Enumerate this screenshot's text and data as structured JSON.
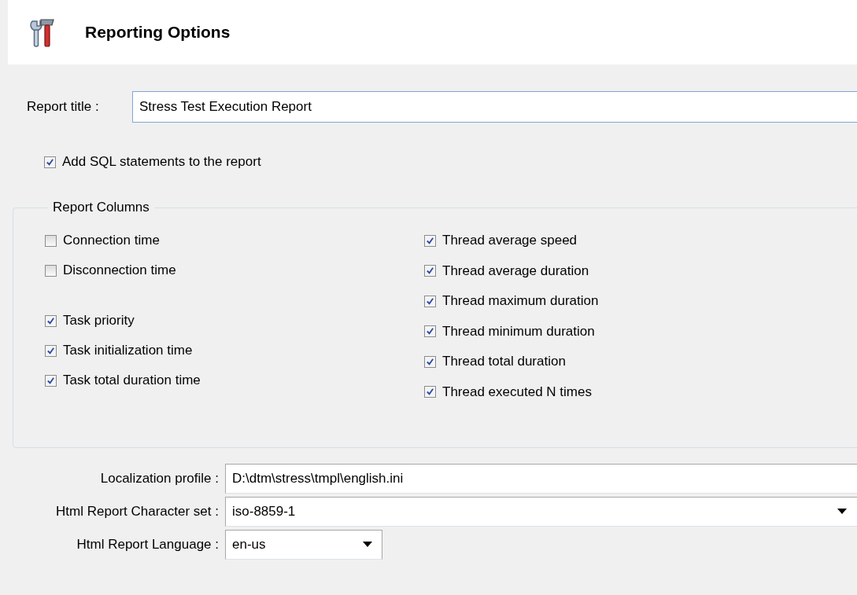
{
  "header": {
    "title": "Reporting Options"
  },
  "report_title": {
    "label": "Report title :",
    "value": "Stress Test Execution Report"
  },
  "add_sql": {
    "label": "Add SQL statements to the report",
    "checked": true
  },
  "report_columns": {
    "title": "Report Columns",
    "columns": [
      {
        "groups": [
          {
            "items": [
              {
                "label": "Connection time",
                "checked": false
              },
              {
                "label": "Disconnection time",
                "checked": false
              }
            ]
          },
          {
            "items": [
              {
                "label": "Task priority",
                "checked": true
              },
              {
                "label": "Task initialization time",
                "checked": true
              },
              {
                "label": "Task total duration time",
                "checked": true
              }
            ]
          }
        ]
      },
      {
        "groups": [
          {
            "items": [
              {
                "label": "Thread average speed",
                "checked": true
              },
              {
                "label": "Thread average duration",
                "checked": true
              },
              {
                "label": "Thread maximum duration",
                "checked": true
              },
              {
                "label": "Thread minimum duration",
                "checked": true
              },
              {
                "label": "Thread total duration",
                "checked": true
              },
              {
                "label": "Thread executed N times",
                "checked": true
              }
            ]
          }
        ]
      }
    ]
  },
  "fields": [
    {
      "kind": "text",
      "label": "Localization profile :",
      "value": "D:\\dtm\\stress\\tmpl\\english.ini"
    },
    {
      "kind": "combo",
      "label": "Html Report Character set :",
      "value": "iso-8859-1"
    },
    {
      "kind": "dropdown",
      "label": "Html Report Language :",
      "value": "en-us"
    }
  ]
}
